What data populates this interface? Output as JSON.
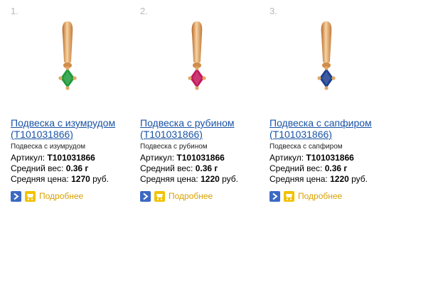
{
  "products": [
    {
      "number": "1.",
      "title_line1": "Подвеска с изумрудом",
      "title_line2": "(T101031866)",
      "subtitle": "Подвеска с изумрудом",
      "article_label": "Артикул: ",
      "article_value": "T101031866",
      "weight_label": "Средний вес: ",
      "weight_value": "0.36 г",
      "price_label": "Средняя цена: ",
      "price_value": "1270",
      "price_unit": " руб.",
      "more_label": "Подробнее",
      "gem_color": "#1f9a3a"
    },
    {
      "number": "2.",
      "title_line1": "Подвеска с рубином",
      "title_line2": "(T101031866)",
      "subtitle": "Подвеска с рубином",
      "article_label": "Артикул: ",
      "article_value": "T101031866",
      "weight_label": "Средний вес: ",
      "weight_value": "0.36 г",
      "price_label": "Средняя цена: ",
      "price_value": "1220",
      "price_unit": " руб.",
      "more_label": "Подробнее",
      "gem_color": "#c2185b"
    },
    {
      "number": "3.",
      "title_line1": "Подвеска с сапфиром",
      "title_line2": "(T101031866)",
      "subtitle": "Подвеска с сапфиром",
      "article_label": "Артикул: ",
      "article_value": "T101031866",
      "weight_label": "Средний вес: ",
      "weight_value": "0.36 г",
      "price_label": "Средняя цена: ",
      "price_value": "1220",
      "price_unit": " руб.",
      "more_label": "Подробнее",
      "gem_color": "#1c3f8f"
    }
  ],
  "colors": {
    "link": "#1a53a6",
    "more": "#d9a100",
    "gold": "#e0a867",
    "arrow_button": "#3b69c4",
    "cart_button": "#f2c200"
  },
  "icons": [
    "arrow-right-icon",
    "cart-icon"
  ]
}
